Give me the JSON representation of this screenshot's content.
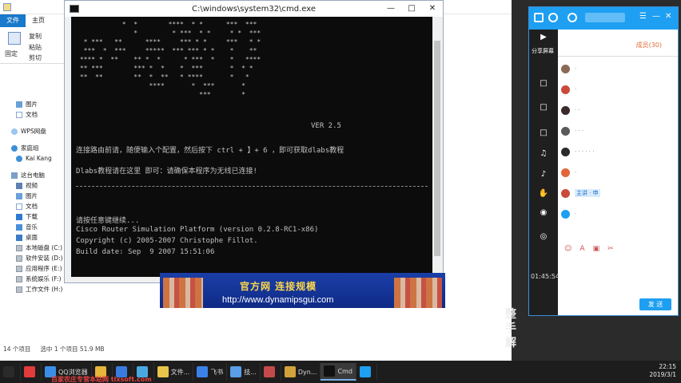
{
  "explorer": {
    "tabs": [
      "文件",
      "主页"
    ],
    "ribbon": {
      "pin_label": "固定",
      "rows": [
        "复制",
        "粘贴",
        "剪切"
      ]
    },
    "nav_items": [
      {
        "label": "图片",
        "icon": "pictures-icon"
      },
      {
        "label": "文档",
        "icon": "documents-icon"
      },
      {
        "label": "WPS网盘",
        "icon": "wps-cloud-icon"
      },
      {
        "label": "家庭组",
        "icon": "homegroup-icon"
      },
      {
        "label": "Kai Kang",
        "icon": "user-icon"
      },
      {
        "label": "这台电脑",
        "icon": "this-pc-icon"
      },
      {
        "label": "视频",
        "icon": "videos-icon"
      },
      {
        "label": "图片",
        "icon": "pictures-icon"
      },
      {
        "label": "文档",
        "icon": "documents-icon"
      },
      {
        "label": "下载",
        "icon": "downloads-icon"
      },
      {
        "label": "音乐",
        "icon": "music-icon"
      },
      {
        "label": "桌面",
        "icon": "desktop-icon"
      },
      {
        "label": "本地磁盘 (C:)",
        "icon": "drive-icon"
      },
      {
        "label": "软件安装 (D:)",
        "icon": "drive-icon"
      },
      {
        "label": "应用程序 (E:)",
        "icon": "drive-icon"
      },
      {
        "label": "系统娱乐 (F:)",
        "icon": "drive-icon"
      },
      {
        "label": "工作文件 (H:)",
        "icon": "drive-icon"
      }
    ],
    "status_count": "14 个项目",
    "status_selected": "选中 1 个项目  51.9 MB"
  },
  "cmd": {
    "title": "C:\\windows\\system32\\cmd.exe",
    "ascii_art": "            *  *        ****  * *      ***  ***\n               *         * ***  * *     * *  ***\n  * ***   **      ****     *** * *     ***   * *\n  ***  *  ***     *****  *** *** * *    *    **\n **** *  **    ** *  *      * ***  *    *   ****\n ** ***        *** *  *    *  ***       *  * *\n **  **        **  *  **   * ****       *   *\n                   ****       *  ***       *\n                                ***        *",
    "ver": "VER 2.5",
    "line1": "连接路由前请，随便输入个配置，然后按下 ctrl + 】+ 6 ，即可获取dlabs教程",
    "line2": "Dlabs教程请在这里 即可：请确保本程序为无线已连接!",
    "prompt1": "请按任意键继续...",
    "info1": "Cisco Router Simulation Platform (version 0.2.8-RC1-x86)",
    "info2": "Copyright (c) 2005-2007 Christophe Fillot.",
    "info3": "Build date: Sep  9 2007 15:51:06"
  },
  "banner": {
    "headline": "官方网 连接规模",
    "url": "http://www.dynamipsgui.com"
  },
  "qq": {
    "share_label": "分享屏幕",
    "tab_members": "成员(30)",
    "members": [
      {
        "name": "·"
      },
      {
        "name": "·"
      },
      {
        "name": "· ·"
      },
      {
        "name": "· · ·"
      },
      {
        "name": "· · · · · ·"
      },
      {
        "name": "·"
      },
      {
        "name": "主讲 · 申"
      },
      {
        "name": "·"
      }
    ],
    "send_label": "发 送"
  },
  "desktop": {
    "time_float": "01:45:54",
    "big_text": "整\n手\n解"
  },
  "taskbar": {
    "items": [
      {
        "label": "",
        "icon": "start-icon",
        "color": "#2a2a2a"
      },
      {
        "label": "",
        "icon": "browser-icon",
        "color": "#e23b3b"
      },
      {
        "label": "QQ浏览器",
        "icon": "qq-browser-icon",
        "color": "#3b8ee8"
      },
      {
        "label": "",
        "icon": "folder-icon",
        "color": "#e8b53b"
      },
      {
        "label": "",
        "icon": "player-icon",
        "color": "#3a7be0"
      },
      {
        "label": "",
        "icon": "app-icon",
        "color": "#4aa8e0"
      },
      {
        "label": "文件...",
        "icon": "explorer-icon",
        "color": "#e8c44a"
      },
      {
        "label": "飞书",
        "icon": "feishu-icon",
        "color": "#3b82e8"
      },
      {
        "label": "技...",
        "icon": "tech-icon",
        "color": "#5a9de8"
      },
      {
        "label": "",
        "icon": "camera-icon",
        "color": "#c44a4a"
      },
      {
        "label": "Dyn...",
        "icon": "dynamips-icon",
        "color": "#d2a33b"
      },
      {
        "label": "Cmd",
        "icon": "cmd-icon",
        "color": "#111111"
      },
      {
        "label": "",
        "icon": "qq-icon",
        "color": "#1e9ff2"
      }
    ],
    "watermark": "百家农庄专营本站网 tlxsoft.com",
    "clock_time": "22:15",
    "clock_date": "2019/3/1"
  }
}
